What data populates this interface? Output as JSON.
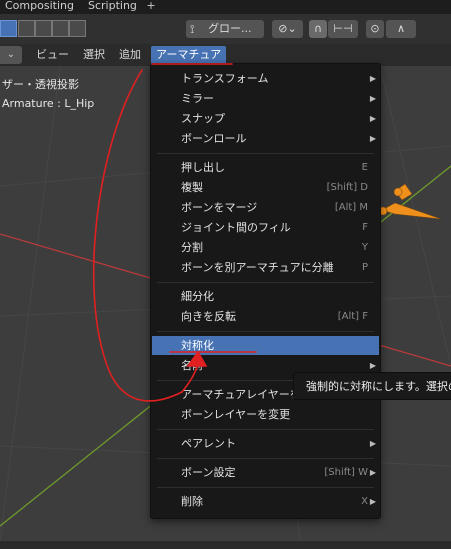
{
  "workspace_tabs": [
    "Compositing",
    "Scripting"
  ],
  "add_tab_label": "+",
  "header": {
    "transform_orientation": "グロー...",
    "snap_dropdown": "⌄",
    "proportional_label": "∧"
  },
  "menus": [
    "ビュー",
    "選択",
    "追加",
    "アーマチュア"
  ],
  "viewport": {
    "view_label": "ザー・透視投影",
    "object_label": "Armature : L_Hip"
  },
  "dropdown": {
    "items": [
      {
        "label": "トランスフォーム",
        "shortcut": "",
        "submenu": true
      },
      {
        "label": "ミラー",
        "shortcut": "",
        "submenu": true
      },
      {
        "label": "スナップ",
        "shortcut": "",
        "submenu": true
      },
      {
        "label": "ボーンロール",
        "shortcut": "",
        "submenu": true
      },
      {
        "label": "押し出し",
        "shortcut": "E",
        "submenu": false
      },
      {
        "label": "複製",
        "shortcut": "[Shift] D",
        "submenu": false
      },
      {
        "label": "ボーンをマージ",
        "shortcut": "[Alt] M",
        "submenu": false
      },
      {
        "label": "ジョイント間のフィル",
        "shortcut": "F",
        "submenu": false
      },
      {
        "label": "分割",
        "shortcut": "Y",
        "submenu": false
      },
      {
        "label": "ボーンを別アーマチュアに分離",
        "shortcut": "P",
        "submenu": false
      },
      {
        "label": "細分化",
        "shortcut": "",
        "submenu": false
      },
      {
        "label": "向きを反転",
        "shortcut": "[Alt] F",
        "submenu": false
      },
      {
        "label": "対称化",
        "shortcut": "",
        "submenu": false
      },
      {
        "label": "名前",
        "shortcut": "",
        "submenu": true
      },
      {
        "label": "アーマチュアレイヤーを変更",
        "shortcut": "",
        "submenu": false
      },
      {
        "label": "ボーンレイヤーを変更",
        "shortcut": "",
        "submenu": false
      },
      {
        "label": "ペアレント",
        "shortcut": "",
        "submenu": true
      },
      {
        "label": "ボーン設定",
        "shortcut": "[Shift] W",
        "submenu": true
      },
      {
        "label": "削除",
        "shortcut": "X",
        "submenu": true
      }
    ]
  },
  "tooltip": "強制的に対称にします。選択の",
  "colors": {
    "accent": "#4772b3",
    "annotation": "#e02020",
    "bone": "#f0901c",
    "x_axis": "#b83a3a",
    "y_axis": "#6e9a2c"
  }
}
